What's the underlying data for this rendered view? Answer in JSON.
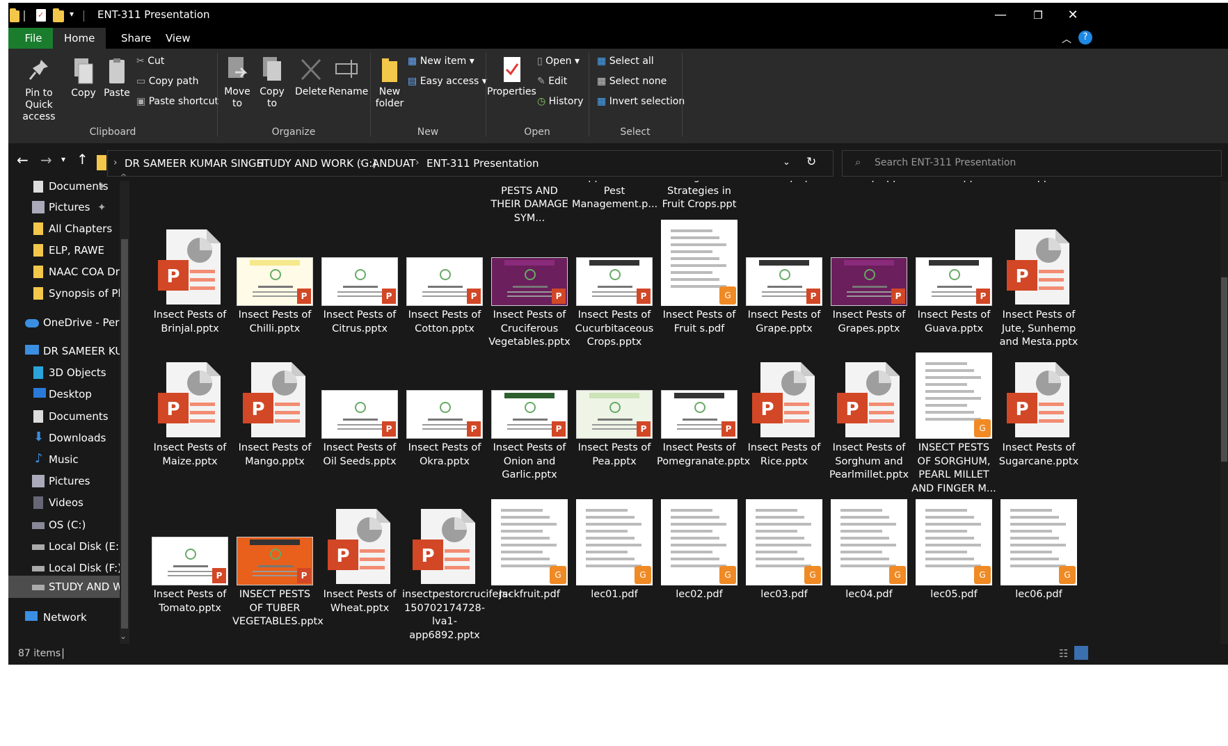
{
  "window": {
    "title": "ENT-311 Presentation"
  },
  "tabs": {
    "file": "File",
    "home": "Home",
    "share": "Share",
    "view": "View"
  },
  "ribbon": {
    "clipboard": {
      "pin": "Pin to Quick access",
      "copy": "Copy",
      "paste": "Paste",
      "cut": "Cut",
      "copy_path": "Copy path",
      "paste_shortcut": "Paste shortcut",
      "group": "Clipboard"
    },
    "organize": {
      "move_to": "Move to",
      "copy_to": "Copy to",
      "delete": "Delete",
      "rename": "Rename",
      "group": "Organize"
    },
    "new": {
      "new_folder": "New folder",
      "new_item": "New item",
      "easy_access": "Easy access",
      "group": "New"
    },
    "open": {
      "properties": "Properties",
      "open": "Open",
      "edit": "Edit",
      "history": "History",
      "group": "Open"
    },
    "select": {
      "select_all": "Select all",
      "select_none": "Select none",
      "invert": "Invert selection",
      "group": "Select"
    }
  },
  "address": {
    "crumbs": [
      "DR SAMEER KUMAR SINGH",
      "STUDY AND WORK (G:)",
      "ANDUAT",
      "ENT-311 Presentation"
    ],
    "search_placeholder": "Search ENT-311 Presentation"
  },
  "nav": {
    "items": [
      "Documents",
      "Pictures",
      "All Chapters",
      "ELP, RAWE",
      "NAAC COA Dr",
      "Synopsis of Ph",
      "OneDrive - Pers",
      "DR SAMEER KU",
      "3D Objects",
      "Desktop",
      "Documents",
      "Downloads",
      "Music",
      "Pictures",
      "Videos",
      "OS (C:)",
      "Local Disk (E:)",
      "Local Disk (F:)",
      "STUDY AND W",
      "Network"
    ]
  },
  "files": {
    "row0": [
      "OF INSECT PESTS AND THEIR DAMAGE SYM...",
      "approches in Pest Management.p...",
      "Management Strategies in Fruit Crops.ppt",
      "Fruit Crops.pdf",
      "Fruit Crops.pptx",
      "Banana.pptx",
      "Ber.pptx"
    ],
    "row1": [
      "Insect Pests of Brinjal.pptx",
      "Insect Pests of Chilli.pptx",
      "Insect Pests of Citrus.pptx",
      "Insect Pests of Cotton.pptx",
      "Insect Pests of Cruciferous Vegetables.pptx",
      "Insect Pests of Cucurbitaceous Crops.pptx",
      "Insect Pests of Fruit s.pdf",
      "Insect Pests of Grape.pptx",
      "Insect Pests of Grapes.pptx",
      "Insect Pests of Guava.pptx",
      "Insect Pests of Jute, Sunhemp and Mesta.pptx"
    ],
    "row2": [
      "Insect Pests of Maize.pptx",
      "Insect Pests of Mango.pptx",
      "Insect Pests of Oil Seeds.pptx",
      "Insect Pests of Okra.pptx",
      "Insect Pests of Onion and Garlic.pptx",
      "Insect Pests of Pea.pptx",
      "Insect Pests of Pomegranate.pptx",
      "Insect Pests of Rice.pptx",
      "Insect Pests of Sorghum and Pearlmillet.pptx",
      "INSECT PESTS OF SORGHUM, PEARL MILLET AND FINGER M...",
      "Insect Pests of Sugarcane.pptx"
    ],
    "row3": [
      "Insect Pests of Tomato.pptx",
      "INSECT PESTS OF TUBER VEGETABLES.pptx",
      "Insect Pests of Wheat.pptx",
      "insectpestorcrucifers-150702174728-lva1-app6892.pptx",
      "Jackfruit.pdf",
      "lec01.pdf",
      "lec02.pdf",
      "lec03.pdf",
      "lec04.pdf",
      "lec05.pdf",
      "lec06.pdf"
    ]
  },
  "status": {
    "count": "87 items"
  }
}
